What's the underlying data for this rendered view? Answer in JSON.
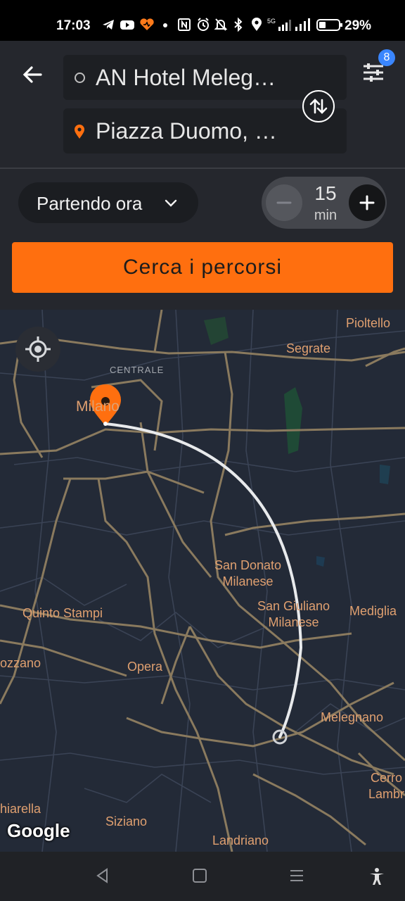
{
  "status_bar": {
    "time": "17:03",
    "battery_percent": "29%",
    "network": "5G"
  },
  "route": {
    "origin": "AN Hotel Meleg…",
    "destination": "Piazza Duomo, …",
    "filter_badge": "8"
  },
  "options": {
    "departure_label": "Partendo ora",
    "stepper_value": "15",
    "stepper_unit": "min"
  },
  "search_button": "Cerca i percorsi",
  "map": {
    "labels": {
      "pioltello": "Pioltello",
      "segrate": "Segrate",
      "centrale": "CENTRALE",
      "milano": "Milano",
      "san_donato": "San Donato\nMilanese",
      "san_giuliano": "San Giuliano\nMilanese",
      "mediglia": "Mediglia",
      "quinto_stampi": "Quinto Stampi",
      "opera": "Opera",
      "rozzano": "ozzano",
      "melegnano": "Melegnano",
      "cerro": "Cerro\nLambr",
      "chiarella": "hiarella",
      "siziano": "Siziano",
      "landriano": "Landriano"
    },
    "attribution": "Google"
  },
  "colors": {
    "accent": "#ff6f0f",
    "badge": "#3a86ff",
    "map_bg": "#232a37",
    "road": "#8a7a5e",
    "route_line": "#e8eaec"
  }
}
